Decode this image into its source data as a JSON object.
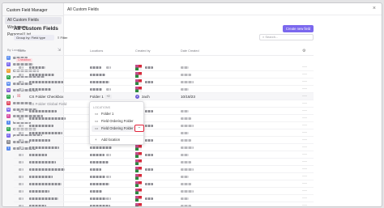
{
  "sidebar": {
    "title": "Custom Field Manager",
    "nav": [
      {
        "label": "All Custom Fields",
        "active": true
      },
      {
        "label": "Workspace",
        "active": false
      },
      {
        "label": "Personal List",
        "active": false
      }
    ],
    "section_label": "By Location",
    "locations": [
      {
        "initial": "E",
        "color": "#5b8def"
      },
      {
        "initial": "E",
        "color": "#7b68ee"
      },
      {
        "initial": "C",
        "color": "#f0a030"
      },
      {
        "initial": "K",
        "color": "#2fa84f"
      },
      {
        "initial": "M",
        "color": "#5b8def"
      },
      {
        "initial": "M",
        "color": "#8a5bd8"
      },
      {
        "initial": "R",
        "color": "#2fa84f"
      },
      {
        "initial": "B",
        "color": "#e0445a"
      },
      {
        "initial": "M",
        "color": "#7b68ee"
      },
      {
        "initial": "E",
        "color": "#d84aa0"
      },
      {
        "initial": "T",
        "color": "#5b8def"
      },
      {
        "initial": "E",
        "color": "#2fa84f"
      },
      {
        "initial": "E",
        "color": "#7b68ee"
      },
      {
        "initial": "S",
        "color": "#8a8a90"
      },
      {
        "initial": "T",
        "color": "#5b8def"
      }
    ]
  },
  "topbar": {
    "title": "All Custom Fields",
    "close_icon": "close-icon"
  },
  "main": {
    "title": "All Custom Fields",
    "create_button": "Create new field",
    "group_by": "Group by: Field type",
    "filter": "Filter",
    "search_placeholder": "Search...",
    "columns": {
      "name": "Name",
      "locations": "Locations",
      "created_by": "Created by",
      "date_created": "Date Created"
    },
    "group_badge": "Checkbox",
    "highlight_row": {
      "name": "CS Folder Checkbox",
      "location": "Folder 1",
      "count": "+2",
      "owner": "zach",
      "date": "10/18/23"
    },
    "partial_row_name": "CS Folder Global Field"
  },
  "popover": {
    "header": "LOCATIONS",
    "items": [
      "Folder 1",
      "Field Ordering Folder",
      "Field Ordering Folder"
    ],
    "add": "Add location",
    "remove_icon": "minus-icon"
  }
}
